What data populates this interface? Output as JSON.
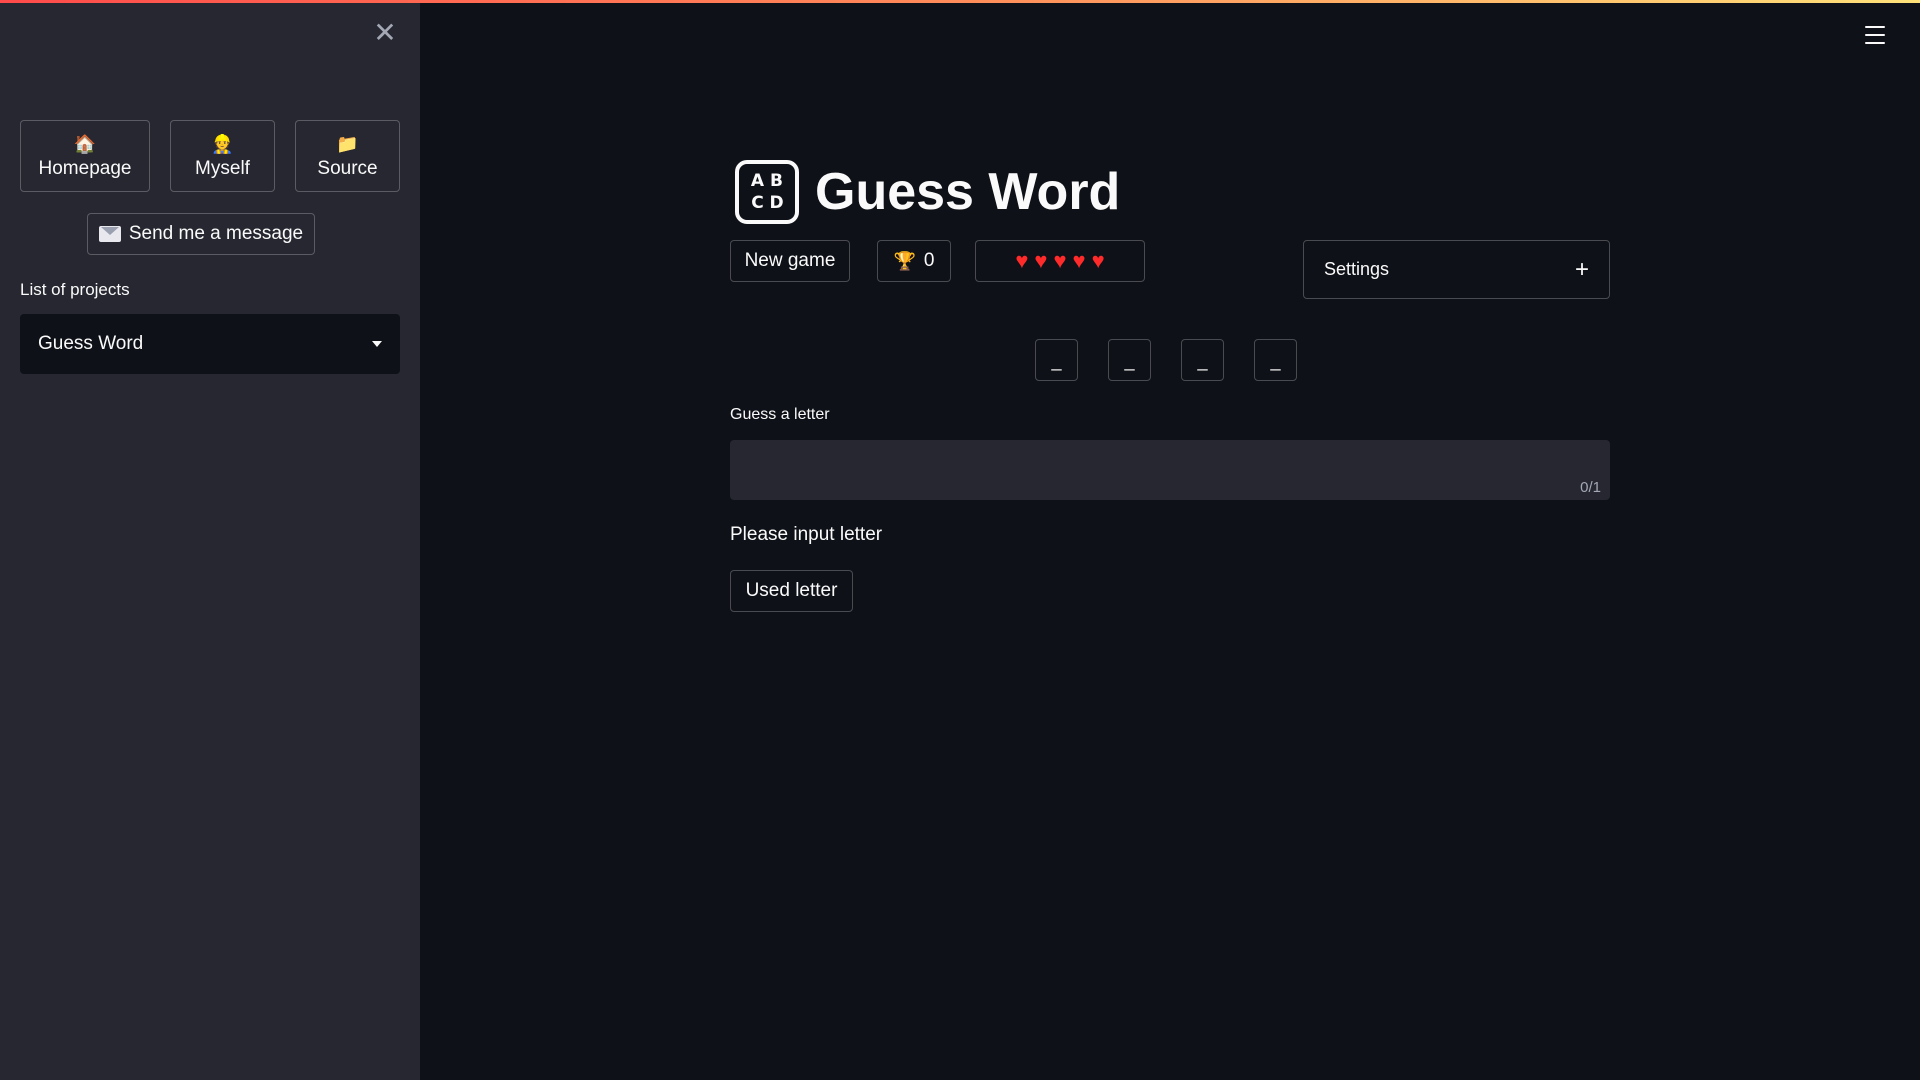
{
  "sidebar": {
    "close_symbol": "✕",
    "nav_buttons": [
      {
        "emoji": "🏠",
        "icon": "house-icon",
        "label": "Homepage"
      },
      {
        "emoji": "👷",
        "icon": "person-icon",
        "label": "Myself"
      },
      {
        "emoji": "📁",
        "icon": "folder-icon",
        "label": "Source"
      }
    ],
    "message_button": {
      "icon": "envelope-icon",
      "label": "Send me a message"
    },
    "projects_label": "List of projects",
    "projects_select": {
      "value": "Guess Word"
    }
  },
  "main": {
    "title": "Guess Word",
    "title_icon": {
      "name": "abcd-icon",
      "letters": [
        "A",
        "B",
        "C",
        "D"
      ]
    },
    "new_game_label": "New game",
    "score": {
      "icon": "trophy-icon",
      "emoji": "🏆",
      "value": "0"
    },
    "lives": {
      "count": 5,
      "symbol": "♥",
      "color": "#ff2a2a"
    },
    "settings_label": "Settings",
    "settings_expand": "+",
    "letter_slots": [
      "_",
      "_",
      "_",
      "_"
    ],
    "guess_label": "Guess a letter",
    "guess_input": {
      "value": "",
      "counter": "0/1"
    },
    "info_text": "Please input letter",
    "used_letter_label": "Used letter"
  },
  "colors": {
    "background": "#0e1117",
    "sidebar": "#262730",
    "heart": "#ff2a2a",
    "accent_gradient": [
      "#ff4b4b",
      "#ffe27a"
    ]
  }
}
